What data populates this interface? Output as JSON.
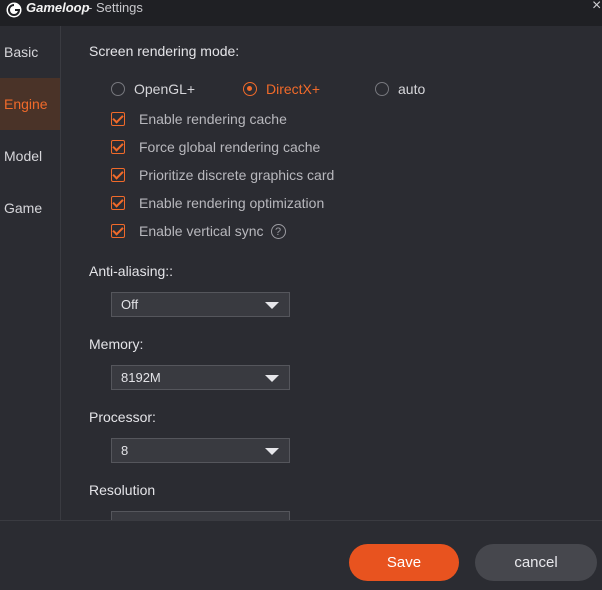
{
  "titlebar": {
    "app_name": "Gameloop",
    "separator_title": "- Settings",
    "close_glyph": "×"
  },
  "sidebar": {
    "items": [
      {
        "label": "Basic",
        "active": false
      },
      {
        "label": "Engine",
        "active": true
      },
      {
        "label": "Model",
        "active": false
      },
      {
        "label": "Game",
        "active": false
      }
    ]
  },
  "engine": {
    "rendering_mode_label": "Screen rendering mode:",
    "rendering_modes": [
      {
        "label": "OpenGL+",
        "selected": false
      },
      {
        "label": "DirectX+",
        "selected": true
      },
      {
        "label": "auto",
        "selected": false
      }
    ],
    "checkboxes": [
      {
        "label": "Enable rendering cache",
        "checked": true
      },
      {
        "label": "Force global rendering cache",
        "checked": true
      },
      {
        "label": "Prioritize discrete graphics card",
        "checked": true
      },
      {
        "label": "Enable rendering optimization",
        "checked": true
      },
      {
        "label": "Enable vertical sync",
        "checked": true,
        "help": "?"
      }
    ],
    "anti_aliasing": {
      "label": "Anti-aliasing::",
      "value": "Off"
    },
    "memory": {
      "label": "Memory:",
      "value": "8192M"
    },
    "processor": {
      "label": "Processor:",
      "value": "8"
    },
    "resolution": {
      "label": "Resolution"
    }
  },
  "footer": {
    "save_label": "Save",
    "cancel_label": "cancel"
  },
  "colors": {
    "accent": "#f06a2a",
    "save_bg": "#e8531f",
    "background": "#2b2c32",
    "titlebar": "#1f2024"
  }
}
